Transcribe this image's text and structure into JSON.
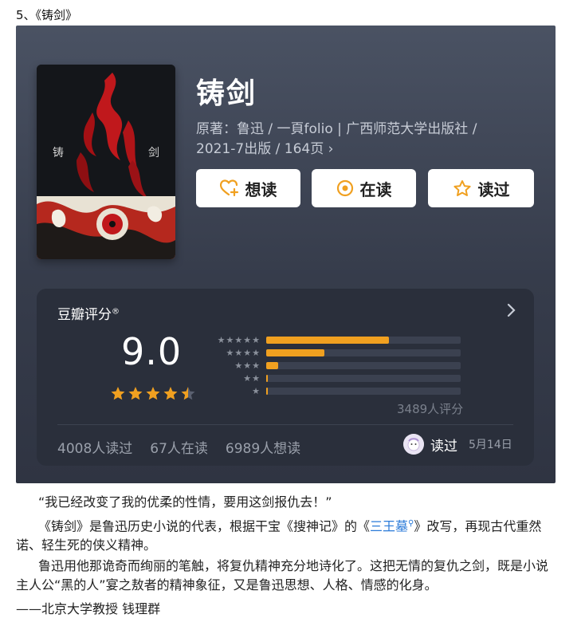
{
  "section_title": "5、《铸剑》",
  "book": {
    "title": "铸剑",
    "meta_line1": "原著：鲁迅 / 一頁folio | 广西师范大学出版社 /",
    "meta_line2": "2021-7出版 / 164页 ›",
    "cover_text_left": "铸",
    "cover_text_right": "剑"
  },
  "buttons": {
    "want": "想读",
    "reading": "在读",
    "read": "读过"
  },
  "rating": {
    "header": "豆瓣评分",
    "header_mark": "®",
    "score": "9.0",
    "stars_value": 4.5,
    "count": "3489人评分",
    "distribution": [
      0.63,
      0.3,
      0.06,
      0.005,
      0.003
    ],
    "stats": [
      "4008人读过",
      "67人在读",
      "6989人想读"
    ],
    "user_status": "读过",
    "user_date": "5月14日"
  },
  "colors": {
    "accent": "#f0a020",
    "card_bg": "#3a4050",
    "panel_bg": "#2a2f3b"
  },
  "text": {
    "quote": "“我已经改变了我的优柔的性情，要用这剑报仇去！”",
    "p2_a": "《铸剑》是鲁迅历史小说的代表，根据干宝《搜神记》的《",
    "p2_link": "三王墓",
    "p2_b": "》改写，再现古代重然诺、轻生死的侠义精神。",
    "p3": "鲁迅用他那诡奇而绚丽的笔触，将复仇精神充分地诗化了。这把无情的复仇之剑，既是小说主人公“黑的人”宴之敖者的精神象征，又是鲁迅思想、人格、情感的化身。",
    "attribution": "——北京大学教授 钱理群"
  }
}
